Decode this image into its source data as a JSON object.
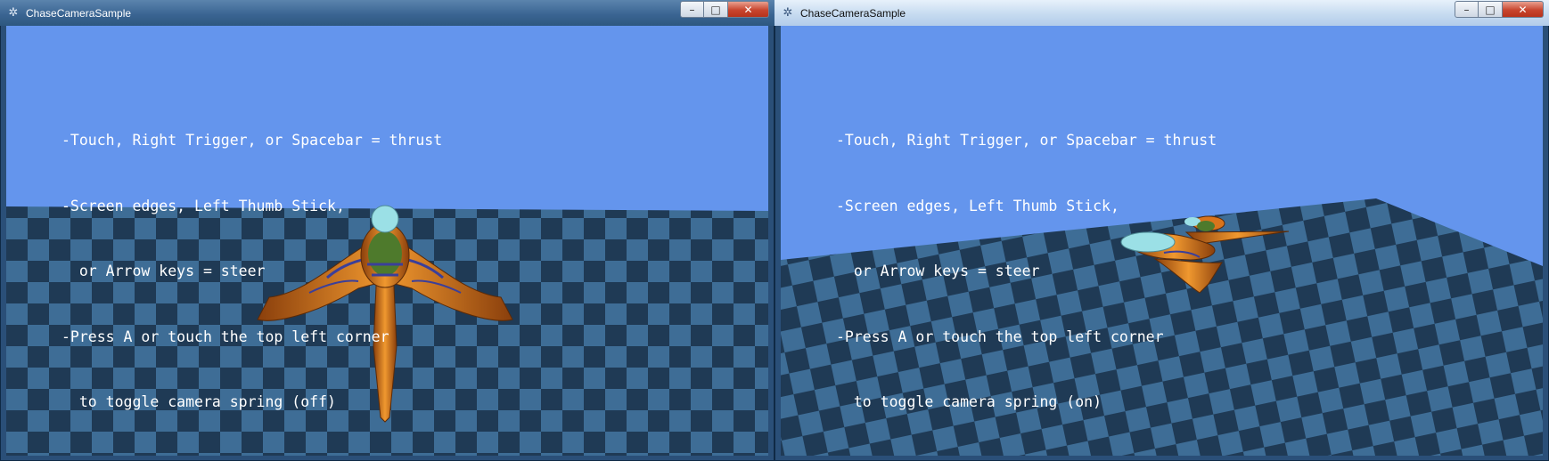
{
  "windows": [
    {
      "title": "ChaseCameraSample",
      "controls": {
        "minimize": "–",
        "maximize": "□",
        "close": "✕"
      },
      "instructions": [
        "-Touch, Right Trigger, or Spacebar = thrust",
        "-Screen edges, Left Thumb Stick,",
        "  or Arrow keys = steer",
        "-Press A or touch the top left corner",
        "  to toggle camera spring (off)"
      ]
    },
    {
      "title": "ChaseCameraSample",
      "controls": {
        "minimize": "–",
        "maximize": "□",
        "close": "✕"
      },
      "instructions": [
        "-Touch, Right Trigger, or Spacebar = thrust",
        "-Screen edges, Left Thumb Stick,",
        "  or Arrow keys = steer",
        "-Press A or touch the top left corner",
        "  to toggle camera spring (on)"
      ]
    }
  ],
  "colors": {
    "sky": "#6495ed",
    "tile_light": "#3e6d96",
    "tile_dark": "#1f3a55",
    "ship_body": "#d9741c",
    "text": "#ffffff"
  },
  "icons": {
    "app": "xna-app-icon",
    "minimize": "minimize-icon",
    "maximize": "maximize-icon",
    "close": "close-icon"
  }
}
